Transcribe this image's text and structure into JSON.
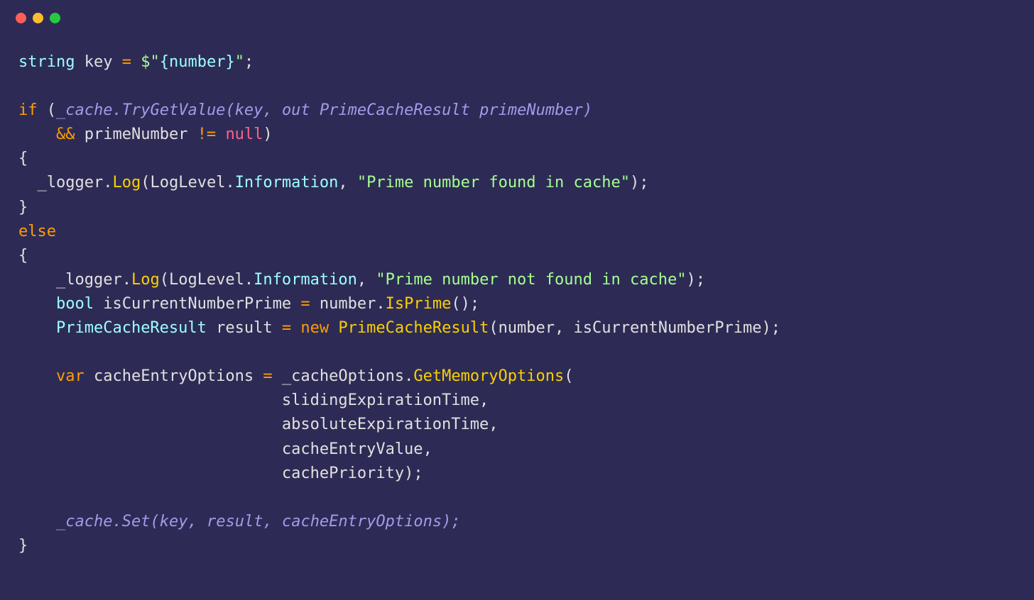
{
  "code": {
    "l1_type": "string",
    "l1_var": "key",
    "l1_eq": "=",
    "l1_str_open": "$\"",
    "l1_interp": "{number}",
    "l1_str_close": "\"",
    "l1_semi": ";",
    "l3_if": "if",
    "l3_paren_open": "(",
    "l3_cache": "_cache",
    "l3_dot": ".",
    "l3_method": "TryGetValue",
    "l3_args_open": "(",
    "l3_arg1": "key",
    "l3_comma1": ",",
    "l3_out": "out",
    "l3_type": "PrimeCacheResult",
    "l3_var": "primeNumber",
    "l3_args_close": ")",
    "l4_and": "&&",
    "l4_var": "primeNumber",
    "l4_neq": "!=",
    "l4_null": "null",
    "l4_paren_close": ")",
    "l5_brace": "{",
    "l6_logger": "_logger",
    "l6_dot1": ".",
    "l6_log": "Log",
    "l6_paren_open": "(",
    "l6_loglevel": "LogLevel",
    "l6_dot2": ".",
    "l6_info": "Information",
    "l6_comma": ",",
    "l6_str": "\"Prime number found in cache\"",
    "l6_paren_close": ")",
    "l6_semi": ";",
    "l7_brace": "}",
    "l8_else": "else",
    "l9_brace": "{",
    "l10_logger": "_logger",
    "l10_dot1": ".",
    "l10_log": "Log",
    "l10_paren_open": "(",
    "l10_loglevel": "LogLevel",
    "l10_dot2": ".",
    "l10_info": "Information",
    "l10_comma": ",",
    "l10_str": "\"Prime number not found in cache\"",
    "l10_paren_close": ")",
    "l10_semi": ";",
    "l11_type": "bool",
    "l11_var": "isCurrentNumberPrime",
    "l11_eq": "=",
    "l11_obj": "number",
    "l11_dot": ".",
    "l11_method": "IsPrime",
    "l11_parens": "()",
    "l11_semi": ";",
    "l12_type": "PrimeCacheResult",
    "l12_var": "result",
    "l12_eq": "=",
    "l12_new": "new",
    "l12_ctor": "PrimeCacheResult",
    "l12_paren_open": "(",
    "l12_arg1": "number",
    "l12_comma": ",",
    "l12_arg2": "isCurrentNumberPrime",
    "l12_paren_close": ")",
    "l12_semi": ";",
    "l14_var_kw": "var",
    "l14_var": "cacheEntryOptions",
    "l14_eq": "=",
    "l14_obj": "_cacheOptions",
    "l14_dot": ".",
    "l14_method": "GetMemoryOptions",
    "l14_paren_open": "(",
    "l15_arg": "slidingExpirationTime",
    "l15_comma": ",",
    "l16_arg": "absoluteExpirationTime",
    "l16_comma": ",",
    "l17_arg": "cacheEntryValue",
    "l17_comma": ",",
    "l18_arg": "cachePriority",
    "l18_paren_close": ")",
    "l18_semi": ";",
    "l20_cache": "_cache",
    "l20_dot": ".",
    "l20_set": "Set",
    "l20_paren_open": "(",
    "l20_arg1": "key",
    "l20_comma1": ",",
    "l20_arg2": "result",
    "l20_comma2": ",",
    "l20_arg3": "cacheEntryOptions",
    "l20_paren_close": ")",
    "l20_semi": ";",
    "l21_brace": "}"
  }
}
